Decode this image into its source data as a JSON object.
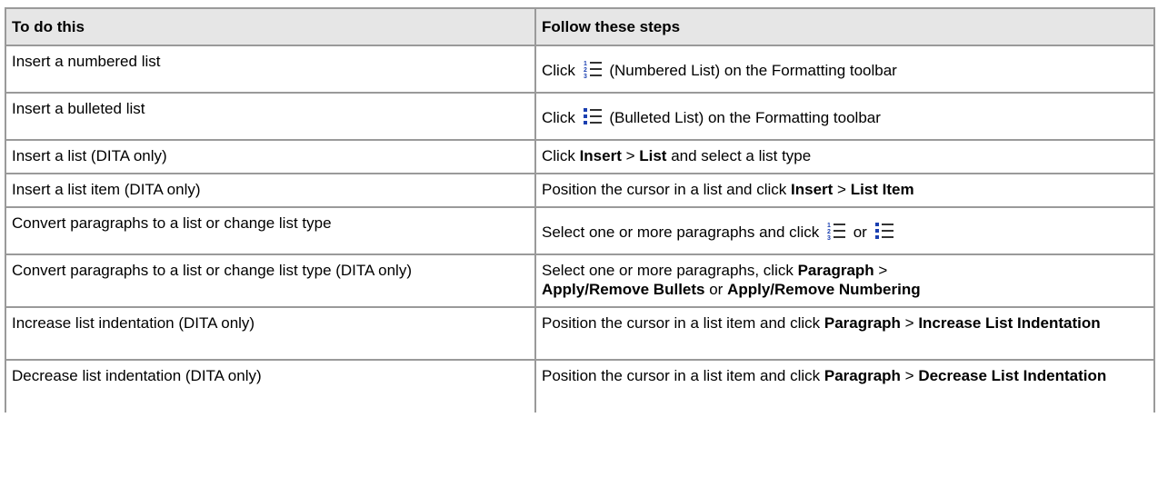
{
  "table": {
    "headers": [
      "To do this",
      "Follow these steps"
    ],
    "rows": [
      {
        "task": "Insert a numbered list",
        "step": {
          "pre": "Click",
          "icon": "numbered-list-icon",
          "post": "(Numbered List) on the Formatting toolbar"
        }
      },
      {
        "task": "Insert a bulleted list",
        "step": {
          "pre": "Click",
          "icon": "bulleted-list-icon",
          "post": "(Bulleted List) on the Formatting toolbar"
        }
      },
      {
        "task": "Insert a list (DITA only)",
        "step": {
          "a": "Click ",
          "b1": "Insert",
          "c": " > ",
          "b2": "List",
          "d": " and select a list type"
        }
      },
      {
        "task": "Insert a list item (DITA only)",
        "step": {
          "a": "Position the cursor in a list and click ",
          "b1": "Insert",
          "c": " > ",
          "b2": "List Item"
        }
      },
      {
        "task": "Convert paragraphs to a list or change list type",
        "step": {
          "pre": "Select one or more paragraphs and click",
          "mid": "or",
          "icons": [
            "numbered-list-icon",
            "bulleted-list-icon"
          ]
        }
      },
      {
        "task": "Convert paragraphs to a list or change list type (DITA only)",
        "step": {
          "a": "Select one or more paragraphs, click ",
          "b1": "Paragraph",
          "c": " > ",
          "b2": "Apply/Remove Bullets",
          "d": " or ",
          "b3": "Apply/Remove Numbering"
        }
      },
      {
        "task": "Increase list indentation (DITA only)",
        "step": {
          "a": "Position the cursor in a list item and click ",
          "b1": "Paragraph",
          "c": " > ",
          "b2": "Increase List Indentation"
        }
      },
      {
        "task": "Decrease list indentation (DITA only)",
        "step": {
          "a": "Position the cursor in a list item and click ",
          "b1": "Paragraph",
          "c": " > ",
          "b2": "Decrease List Indentation"
        }
      }
    ]
  },
  "colors": {
    "header_bg": "#e6e6e6",
    "border": "#9a9a9a",
    "icon_blue": "#1a3fb0"
  }
}
